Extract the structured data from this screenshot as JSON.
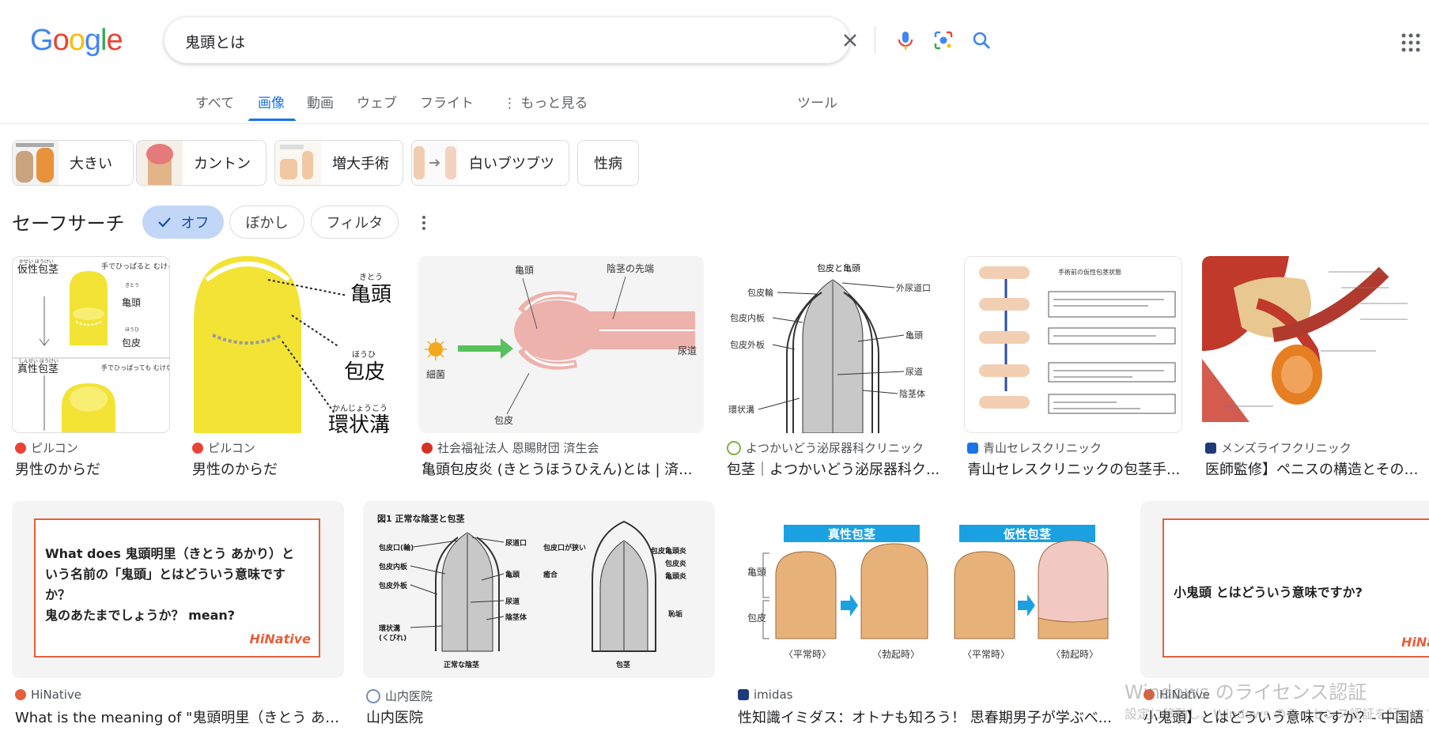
{
  "logo": {
    "text": "Google"
  },
  "search": {
    "query": "鬼頭とは"
  },
  "tabs": [
    "すべて",
    "画像",
    "動画",
    "ウェブ",
    "フライト",
    "もっと見る",
    "ツール"
  ],
  "chips": [
    "大きい",
    "カントン",
    "増大手術",
    "白いブツブツ",
    "性病"
  ],
  "safesearch": {
    "title": "セーフサーチ",
    "options": [
      "オフ",
      "ぼかし",
      "フィルタ"
    ]
  },
  "results_row1": [
    {
      "source": "ピルコン",
      "title": "男性のからだ"
    },
    {
      "source": "ピルコン",
      "title": "男性のからだ"
    },
    {
      "source": "社会福祉法人 恩賜財団 済生会",
      "title": "亀頭包皮炎 (きとうほうひえん)とは | 済..."
    },
    {
      "source": "よつかいどう泌尿器科クリニック",
      "title": "包茎｜よつかいどう泌尿器科ク..."
    },
    {
      "source": "青山セレスクリニック",
      "title": "青山セレスクリニックの包茎手..."
    },
    {
      "source": "メンズライフクリニック",
      "title": "医師監修】ペニスの構造とその役割"
    }
  ],
  "results_row2": [
    {
      "source": "HiNative",
      "title": "What is the meaning of \"鬼頭明里（きとう あか..."
    },
    {
      "source": "山内医院",
      "title": "山内医院"
    },
    {
      "source": "imidas",
      "title": "性知識イミダス：オトナも知ろう！ 思春期男子が学ぶべ..."
    },
    {
      "source": "HiNative",
      "title": "小鬼頭】とはどういう意味ですか？- 中国語"
    }
  ],
  "image_text": {
    "pilcon1": {
      "top_label": "仮性包茎",
      "top_ruby": "かせい ほうけい",
      "note1": "手でひっぱると むける",
      "kito": "亀頭",
      "kito_ruby": "きとう",
      "hohi": "包皮",
      "hohi_ruby": "ほうひ",
      "bottom_label": "真性包茎",
      "bottom_ruby": "しんせい ほうけい",
      "note2": "手でひっぱっても むけない…"
    },
    "pilcon2": {
      "kito": "亀頭",
      "kito_ruby": "きとう",
      "hohi": "包皮",
      "hohi_ruby": "ほうひ",
      "kanjo": "環状溝",
      "kanjo_ruby": "かんじょうこう"
    },
    "saiseikai": {
      "l1": "亀頭",
      "l2": "陰茎の先端",
      "l3": "尿道",
      "l4": "細菌",
      "l5": "包皮"
    },
    "yotsukaido": {
      "title": "包皮と亀頭",
      "l1": "包皮輪",
      "l2": "包皮内板",
      "l3": "包皮外板",
      "l4": "環状溝",
      "r1": "外尿道口",
      "r2": "亀頭",
      "r3": "尿道",
      "r4": "陰茎体"
    },
    "aoyama": {
      "title": "手術前の仮性包茎状態"
    },
    "hinative1": {
      "text1": "What does 鬼頭明里（きとう あかり）と",
      "text2": "いう名前の「鬼頭」とはどういう意味です",
      "text3": "か？",
      "text4": "鬼のあたまでしょうか？ mean?",
      "brand": "HiNative"
    },
    "yamauchi": {
      "title": "図1 正常な陰茎と包茎",
      "l1": "包皮口(輪)",
      "l2": "包皮内板",
      "l3": "包皮外板",
      "l4": "環状溝",
      "l4b": "(くびれ)",
      "m1": "尿道口",
      "m2": "亀頭",
      "m3": "尿道",
      "m4": "陰茎体",
      "r0": "包皮口が狭い",
      "r1": "包皮亀頭炎",
      "r2": "包皮炎",
      "r3": "亀頭炎",
      "r4": "癒合",
      "r5": "恥垢",
      "c1": "正常な陰茎",
      "c2": "包茎"
    },
    "imidas": {
      "h1": "真性包茎",
      "h2": "仮性包茎",
      "side1": "亀頭",
      "side2": "包皮",
      "c1": "〈平常時〉",
      "c2": "〈勃起時〉",
      "c3": "〈平常時〉",
      "c4": "〈勃起時〉"
    },
    "hinative2": {
      "text": "小鬼頭 とはどういう意味ですか?",
      "brand": "HiNative"
    }
  },
  "watermark": {
    "line1": "Windows のライセンス認証",
    "line2": "設定に移動し、Windows のライセンス認証を行います。"
  },
  "colors": {
    "blue": "#1a73e8",
    "google_blue": "#4285f4",
    "google_red": "#ea4335",
    "google_yellow": "#fbbc05",
    "google_green": "#34a853"
  }
}
